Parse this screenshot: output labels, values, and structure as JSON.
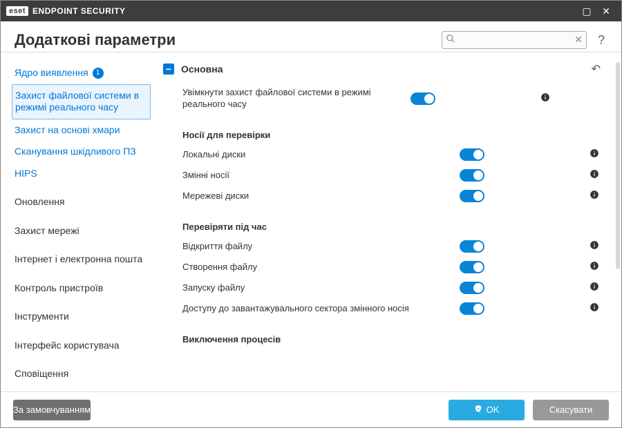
{
  "titlebar": {
    "brand_mark": "eset",
    "brand_text": "ENDPOINT SECURITY"
  },
  "header": {
    "title": "Додаткові параметри",
    "search_placeholder": ""
  },
  "sidebar": {
    "detection_group": [
      {
        "label": "Ядро виявлення",
        "badge": "1"
      },
      {
        "label": "Захист файлової системи в режимі реального часу",
        "active": true
      },
      {
        "label": "Захист на основі хмари"
      },
      {
        "label": "Сканування шкідливого ПЗ"
      },
      {
        "label": "HIPS"
      }
    ],
    "items": [
      {
        "label": "Оновлення"
      },
      {
        "label": "Захист мережі"
      },
      {
        "label": "Інтернет і електронна пошта"
      },
      {
        "label": "Контроль пристроїв"
      },
      {
        "label": "Інструменти"
      },
      {
        "label": "Інтерфейс користувача"
      },
      {
        "label": "Сповіщення"
      }
    ]
  },
  "content": {
    "section_title": "Основна",
    "enable_rt": {
      "label": "Увімкнути захист файлової системи в режимі реального часу",
      "on": true
    },
    "media_head": "Носії для перевірки",
    "media": [
      {
        "label": "Локальні диски",
        "on": true
      },
      {
        "label": "Змінні носії",
        "on": true
      },
      {
        "label": "Мережеві диски",
        "on": true
      }
    ],
    "scanon_head": "Перевіряти під час",
    "scanon": [
      {
        "label": "Відкриття файлу",
        "on": true
      },
      {
        "label": "Створення файлу",
        "on": true
      },
      {
        "label": "Запуску файлу",
        "on": true
      },
      {
        "label": "Доступу до завантажувального сектора змінного носія",
        "on": true
      }
    ],
    "exclusions_head": "Виключення процесів"
  },
  "footer": {
    "defaults": "За замовчуванням",
    "ok": "OK",
    "cancel": "Скасувати"
  }
}
